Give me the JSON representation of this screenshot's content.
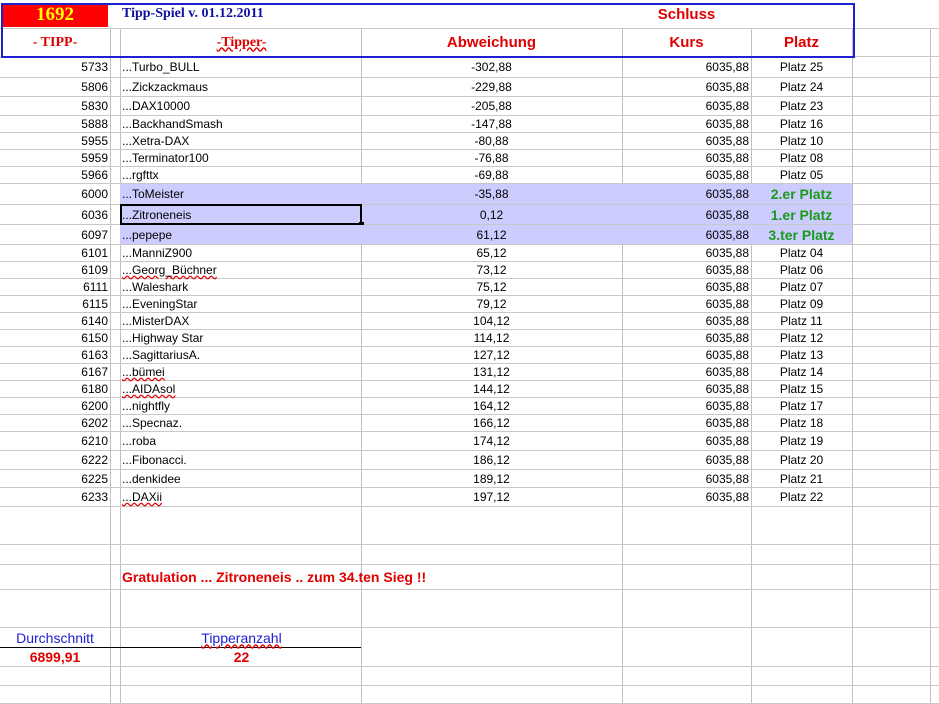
{
  "header": {
    "count": "1692",
    "title": "Tipp-Spiel v. 01.12.2011",
    "tipp": "- TIPP-",
    "tipper": "-Tipper-",
    "abweichung": "Abweichung",
    "schluss": "Schluss",
    "kurs": "Kurs",
    "platz": "Platz"
  },
  "rows": [
    {
      "tipp": "5733",
      "name": "...Turbo_BULL",
      "diff": "-302,88",
      "kurs": "6035,88",
      "platz": "Platz 25"
    },
    {
      "tipp": "5806",
      "name": "...Zickzackmaus",
      "diff": "-229,88",
      "kurs": "6035,88",
      "platz": "Platz 24"
    },
    {
      "tipp": "5830",
      "name": "...DAX10000",
      "diff": "-205,88",
      "kurs": "6035,88",
      "platz": "Platz 23"
    },
    {
      "tipp": "5888",
      "name": "...BackhandSmash",
      "diff": "-147,88",
      "kurs": "6035,88",
      "platz": "Platz 16"
    },
    {
      "tipp": "5955",
      "name": "...Xetra-DAX",
      "diff": "-80,88",
      "kurs": "6035,88",
      "platz": "Platz 10"
    },
    {
      "tipp": "5959",
      "name": "...Terminator100",
      "diff": "-76,88",
      "kurs": "6035,88",
      "platz": "Platz 08"
    },
    {
      "tipp": "5966",
      "name": "...rgfttx",
      "diff": "-69,88",
      "kurs": "6035,88",
      "platz": "Platz 05"
    },
    {
      "tipp": "6000",
      "name": "...ToMeister",
      "diff": "-35,88",
      "kurs": "6035,88",
      "platz": "2.er Platz"
    },
    {
      "tipp": "6036",
      "name": "...Zitroneneis",
      "diff": "0,12",
      "kurs": "6035,88",
      "platz": "1.er Platz"
    },
    {
      "tipp": "6097",
      "name": "...pepepe",
      "diff": "61,12",
      "kurs": "6035,88",
      "platz": "3.ter Platz"
    },
    {
      "tipp": "6101",
      "name": "...ManniZ900",
      "diff": "65,12",
      "kurs": "6035,88",
      "platz": "Platz 04"
    },
    {
      "tipp": "6109",
      "name": "...Georg_Büchner",
      "diff": "73,12",
      "kurs": "6035,88",
      "platz": "Platz 06"
    },
    {
      "tipp": "6111",
      "name": "...Waleshark",
      "diff": "75,12",
      "kurs": "6035,88",
      "platz": "Platz 07"
    },
    {
      "tipp": "6115",
      "name": "...EveningStar",
      "diff": "79,12",
      "kurs": "6035,88",
      "platz": "Platz 09"
    },
    {
      "tipp": "6140",
      "name": "...MisterDAX",
      "diff": "104,12",
      "kurs": "6035,88",
      "platz": "Platz 11"
    },
    {
      "tipp": "6150",
      "name": "...Highway Star",
      "diff": "114,12",
      "kurs": "6035,88",
      "platz": "Platz 12"
    },
    {
      "tipp": "6163",
      "name": "...SagittariusA.",
      "diff": "127,12",
      "kurs": "6035,88",
      "platz": "Platz 13"
    },
    {
      "tipp": "6167",
      "name": "...bümei",
      "diff": "131,12",
      "kurs": "6035,88",
      "platz": "Platz 14"
    },
    {
      "tipp": "6180",
      "name": "...AIDAsol",
      "diff": "144,12",
      "kurs": "6035,88",
      "platz": "Platz 15"
    },
    {
      "tipp": "6200",
      "name": "...nightfly",
      "diff": "164,12",
      "kurs": "6035,88",
      "platz": "Platz 17"
    },
    {
      "tipp": "6202",
      "name": "...Specnaz.",
      "diff": "166,12",
      "kurs": "6035,88",
      "platz": "Platz 18"
    },
    {
      "tipp": "6210",
      "name": "...roba",
      "diff": "174,12",
      "kurs": "6035,88",
      "platz": "Platz 19"
    },
    {
      "tipp": "6222",
      "name": "...Fibonacci.",
      "diff": "186,12",
      "kurs": "6035,88",
      "platz": "Platz 20"
    },
    {
      "tipp": "6225",
      "name": "...denkidee",
      "diff": "189,12",
      "kurs": "6035,88",
      "platz": "Platz 21"
    },
    {
      "tipp": "6233",
      "name": "...DAXii",
      "diff": "197,12",
      "kurs": "6035,88",
      "platz": "Platz 22"
    }
  ],
  "footer": {
    "gratulation": "Gratulation ... Zitroneneis .. zum  34.ten Sieg !!",
    "durchschnitt_label": "Durchschnitt",
    "durchschnitt": "6899,91",
    "tipperanzahl_label": "Tipperanzahl",
    "tipperanzahl": "22"
  }
}
